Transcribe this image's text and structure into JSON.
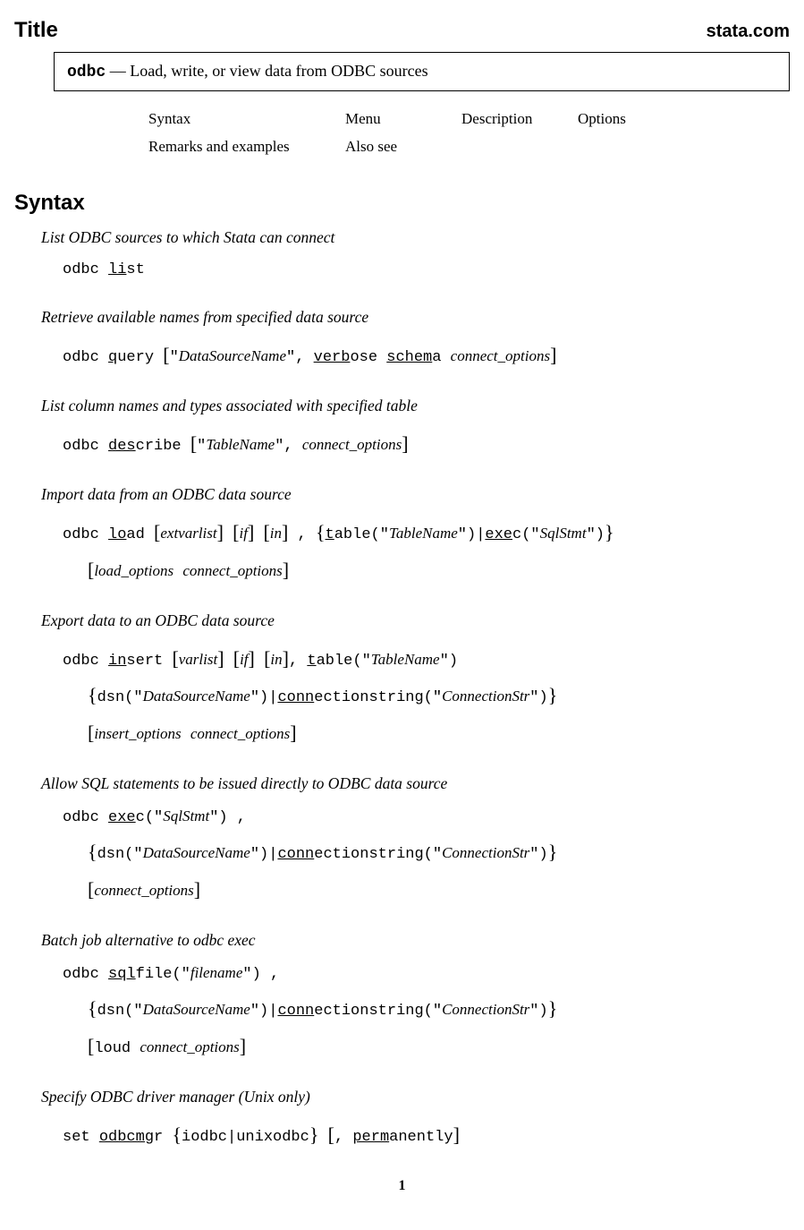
{
  "header": {
    "title": "Title",
    "site": "stata.com"
  },
  "titlebox": {
    "cmd": "odbc",
    "sep": " — ",
    "desc": "Load, write, or view data from ODBC sources"
  },
  "nav": {
    "r1c1": "Syntax",
    "r1c2": "Menu",
    "r1c3": "Description",
    "r1c4": "Options",
    "r2c1": "Remarks and examples",
    "r2c2": "Also see"
  },
  "section": "Syntax",
  "e1": {
    "desc": "List ODBC sources to which Stata can connect",
    "odbc": "odbc ",
    "u": "li",
    "rest": "st"
  },
  "e2": {
    "desc": "Retrieve available names from specified data source",
    "odbc": "odbc ",
    "u1": "q",
    "t1": "uery ",
    "b1": "[",
    "q1": "\"",
    "it1": "DataSourceName",
    "q2": "\"",
    "t2": ", ",
    "u2": "verb",
    "t3": "ose ",
    "u3": "schem",
    "t4": "a ",
    "it2": "connect_options",
    "b2": "]"
  },
  "e3": {
    "desc": "List column names and types associated with specified table",
    "odbc": "odbc ",
    "u1": "des",
    "t1": "cribe ",
    "b1": "[",
    "q1": "\"",
    "it1": "TableName",
    "q2": "\"",
    "t2": ", ",
    "it2": "connect_options",
    "b2": "]"
  },
  "e4": {
    "desc": "Import data from an ODBC data source",
    "odbc": "odbc ",
    "u1": "lo",
    "t1": "ad ",
    "b1": "[",
    "it1": "extvarlist",
    "b2": "]",
    " ": " ",
    "b3": "[",
    "it2": "if",
    "b4": "]",
    " 2": " ",
    "b5": "[",
    "it3": "in",
    "b6": "]",
    "t2": " , ",
    "c1": "{",
    "u2": "t",
    "t3": "able(",
    "q1": "\"",
    "it4": "TableName",
    "q2": "\"",
    "t4": ")",
    "pipe": "|",
    "u3": "exe",
    "t5": "c(",
    "q3": "\"",
    "it5": "SqlStmt",
    "q4": "\"",
    "t6": ")",
    "c2": "}",
    "l2b1": "[",
    "l2it1": "load_options",
    "l2sp": " ",
    "l2it2": "connect_options",
    "l2b2": "]"
  },
  "e5": {
    "desc": "Export data to an ODBC data source",
    "odbc": "odbc ",
    "u1": "in",
    "t1": "sert ",
    "b1": "[",
    "it1": "varlist",
    "b2": "]",
    " ": " ",
    "b3": "[",
    "it2": "if",
    "b4": "]",
    " 2": " ",
    "b5": "[",
    "it3": "in",
    "b6": "]",
    "t2": ", ",
    "u2": "t",
    "t3": "able(",
    "q1": "\"",
    "it4": "TableName",
    "q2": "\"",
    "t4": ")",
    "l2c1": "{",
    "l2t1": "dsn(",
    "l2q1": "\"",
    "l2it1": "DataSourceName",
    "l2q2": "\"",
    "l2t2": ")",
    "l2pipe": "|",
    "l2u1": "conn",
    "l2t3": "ectionstring(",
    "l2q3": "\"",
    "l2it2": "ConnectionStr",
    "l2q4": "\"",
    "l2t4": ")",
    "l2c2": "}",
    "l3b1": "[",
    "l3it1": "insert_options",
    "l3sp": " ",
    "l3it2": "connect_options",
    "l3b2": "]"
  },
  "e6": {
    "desc": "Allow SQL statements to be issued directly to ODBC data source",
    "odbc": "odbc ",
    "u1": "exe",
    "t1": "c(",
    "q1": "\"",
    "it1": "SqlStmt",
    "q2": "\"",
    "t2": ") ,",
    "l2c1": "{",
    "l2t1": "dsn(",
    "l2q1": "\"",
    "l2it1": "DataSourceName",
    "l2q2": "\"",
    "l2t2": ")",
    "l2pipe": "|",
    "l2u1": "conn",
    "l2t3": "ectionstring(",
    "l2q3": "\"",
    "l2it2": "ConnectionStr",
    "l2q4": "\"",
    "l2t4": ")",
    "l2c2": "}",
    "l3b1": "[",
    "l3it1": "connect_options",
    "l3b2": "]"
  },
  "e7": {
    "desc": "Batch job alternative to odbc exec",
    "odbc": "odbc ",
    "u1": "sql",
    "t1": "file(",
    "q1": "\"",
    "it1": "filename",
    "q2": "\"",
    "t2": ") ,",
    "l2c1": "{",
    "l2t1": "dsn(",
    "l2q1": "\"",
    "l2it1": "DataSourceName",
    "l2q2": "\"",
    "l2t2": ")",
    "l2pipe": "|",
    "l2u1": "conn",
    "l2t3": "ectionstring(",
    "l2q3": "\"",
    "l2it2": "ConnectionStr",
    "l2q4": "\"",
    "l2t4": ")",
    "l2c2": "}",
    "l3b1": "[",
    "l3t1": "loud ",
    "l3it1": "connect_options",
    "l3b2": "]"
  },
  "e8": {
    "desc": "Specify ODBC driver manager (Unix only)",
    "t1": "set ",
    "u1": "odbcmg",
    "t2": "r ",
    "c1": "{",
    "t3": "iodbc",
    "pipe": "|",
    "t4": "unixodbc",
    "c2": "}",
    "sp": " ",
    "b1": "[",
    "t5": ", ",
    "u2": "perm",
    "t6": "anently",
    "b2": "]"
  },
  "page": "1"
}
